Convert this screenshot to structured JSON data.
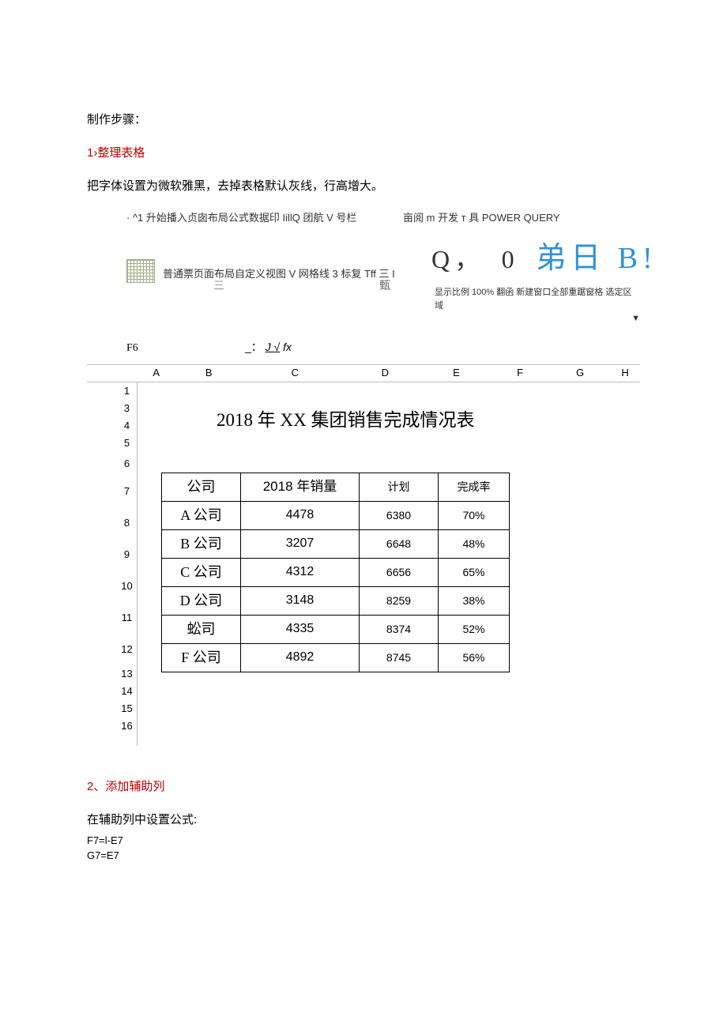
{
  "intro": "制作步骤：",
  "step1": {
    "heading": "1›整理表格",
    "desc": "把字体设置为微软雅黑，去掉表格默认灰线，行高增大。"
  },
  "ribbon": {
    "tabs_left": "· ^1 升始播入贞囱布局公式数据印 IillQ 团航 V 号栏",
    "tabs_right": "亩阅  m 开发 т 具  POWER QUERY",
    "row2_text": "普通票页面布局自定义视图 V 网格线 3 标复 Tff 三 I",
    "bigglyph_q": "Q，",
    "bigglyph_zero": "0",
    "bigglyph_blue": "弟日 B!",
    "san": "三",
    "zhen": "甄",
    "row3_right": "显示比例 100%  翻函  新建窗口全部重踞窗格  选定区域",
    "tri": "▼",
    "cell_ref": "F6",
    "fx_pre": "_：",
    "fx_j": "  J  ",
    "fx_check": "√",
    "fx_fx": "fx"
  },
  "columns": [
    "A",
    "B",
    "C",
    "D",
    "E",
    "F",
    "G",
    "H"
  ],
  "row_numbers": [
    "1",
    "3",
    "4",
    "5",
    "6",
    "7",
    "8",
    "9",
    "10",
    "11",
    "12",
    "13",
    "14",
    "15",
    "16"
  ],
  "sheet_title": "2018 年 XX 集团销售完成情况表",
  "table": {
    "headers": [
      "公司",
      "2018 年销量",
      "计划",
      "完成率"
    ],
    "rows": [
      {
        "co": "A 公司",
        "sales": "4478",
        "plan": "6380",
        "rate": "70%"
      },
      {
        "co": "B 公司",
        "sales": "3207",
        "plan": "6648",
        "rate": "48%"
      },
      {
        "co": "C 公司",
        "sales": "4312",
        "plan": "6656",
        "rate": "65%"
      },
      {
        "co": "D 公司",
        "sales": "3148",
        "plan": "8259",
        "rate": "38%"
      },
      {
        "co": "蚣司",
        "sales": "4335",
        "plan": "8374",
        "rate": "52%"
      },
      {
        "co": "F 公司",
        "sales": "4892",
        "plan": "8745",
        "rate": "56%"
      }
    ]
  },
  "step2": {
    "heading": "2、添加辅助列",
    "desc": "在辅助列中设置公式:",
    "formula1": "F7=l-E7",
    "formula2": "G7=E7"
  }
}
